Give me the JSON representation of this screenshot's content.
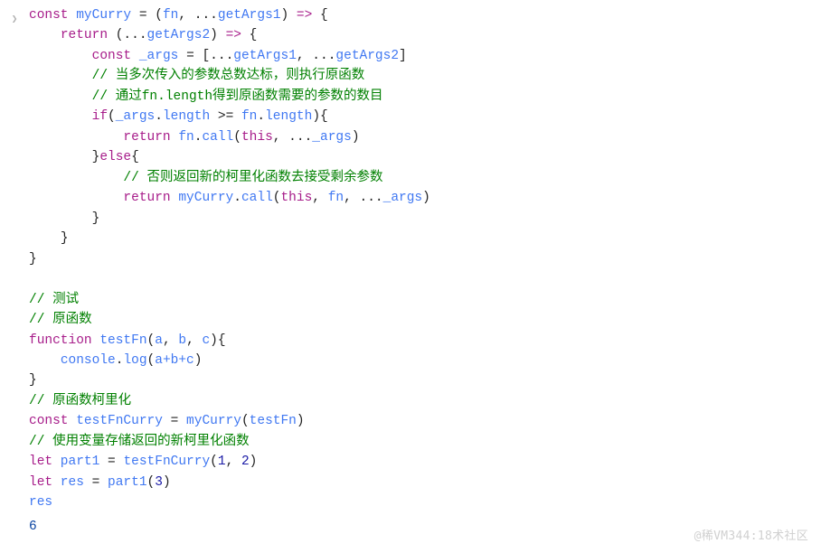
{
  "colors": {
    "keyword": "#a71d8a",
    "function": "#4078f2",
    "comment": "#008000",
    "text": "#222222",
    "number": "#1a1aa6",
    "output": "#0842a0",
    "gutter": "#bbbbbb"
  },
  "prompt_glyph": "❯",
  "lines": {
    "l1_const": "const",
    "l1_ident": " myCurry ",
    "l1_eq": "= (",
    "l1_fn": "fn",
    "l1_comma": ", ...",
    "l1_arg1": "getArgs1",
    "l1_close": ") ",
    "l1_arrow": "=>",
    "l1_brace": " {",
    "l2_return": "return",
    "l2_open": " (...",
    "l2_arg2": "getArgs2",
    "l2_close": ") ",
    "l2_arrow": "=>",
    "l2_brace": " {",
    "l3_const": "const",
    "l3_ident": " _args ",
    "l3_eq": "= [...",
    "l3_a": "getArgs1",
    "l3_c": ", ...",
    "l3_b": "getArgs2",
    "l3_end": "]",
    "l4": "// 当多次传入的参数总数达标，则执行原函数",
    "l5": "// 通过fn.length得到原函数需要的参数的数目",
    "l6_if": "if",
    "l6_open": "(",
    "l6_a": "_args",
    "l6_dot": ".",
    "l6_len": "length",
    "l6_ge": " >= ",
    "l6_b": "fn",
    "l6_dot2": ".",
    "l6_len2": "length",
    "l6_close": "){",
    "l7_return": "return",
    "l7_sp": " ",
    "l7_fn": "fn",
    "l7_dot": ".",
    "l7_call": "call",
    "l7_open": "(",
    "l7_this": "this",
    "l7_c": ", ...",
    "l7_args": "_args",
    "l7_close": ")",
    "l8": "}",
    "l8_else": "else",
    "l8_b": "{",
    "l9": "// 否则返回新的柯里化函数去接受剩余参数",
    "l10_return": "return",
    "l10_sp": " ",
    "l10_my": "myCurry",
    "l10_dot": ".",
    "l10_call": "call",
    "l10_open": "(",
    "l10_this": "this",
    "l10_c1": ", ",
    "l10_fn": "fn",
    "l10_c2": ", ...",
    "l10_args": "_args",
    "l10_close": ")",
    "l11": "}",
    "l12": "}",
    "l13": "}",
    "l15": "// 测试",
    "l16": "// 原函数",
    "l17_fn": "function",
    "l17_name": " testFn",
    "l17_open": "(",
    "l17_a": "a",
    "l17_c1": ", ",
    "l17_b": "b",
    "l17_c2": ", ",
    "l17_c": "c",
    "l17_close": "){",
    "l18_a": "console",
    "l18_dot": ".",
    "l18_log": "log",
    "l18_open": "(",
    "l18_expr": "a+b+c",
    "l18_close": ")",
    "l19": "}",
    "l20": "// 原函数柯里化",
    "l21_const": "const",
    "l21_name": " testFnCurry ",
    "l21_eq": "= ",
    "l21_call": "myCurry",
    "l21_open": "(",
    "l21_arg": "testFn",
    "l21_close": ")",
    "l22": "// 使用变量存储返回的新柯里化函数",
    "l23_let": "let",
    "l23_name": " part1 ",
    "l23_eq": "= ",
    "l23_call": "testFnCurry",
    "l23_open": "(",
    "l23_n1": "1",
    "l23_c": ", ",
    "l23_n2": "2",
    "l23_close": ")",
    "l24_let": "let",
    "l24_name": " res ",
    "l24_eq": "= ",
    "l24_call": "part1",
    "l24_open": "(",
    "l24_n": "3",
    "l24_close": ")",
    "l25": "res"
  },
  "output": "6",
  "watermark": "@稀VM344:18术社区"
}
